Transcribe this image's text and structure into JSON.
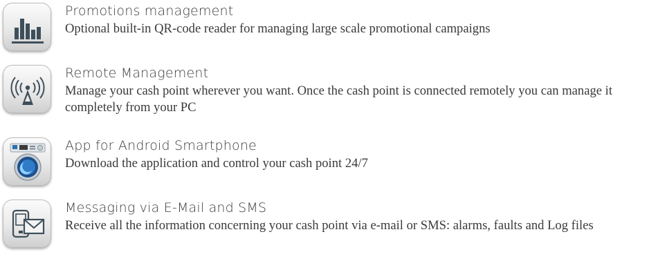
{
  "features": [
    {
      "icon": "bar-chart-icon",
      "title": "Promotions management",
      "description": "Optional built-in QR-code reader for managing large scale promotional campaigns"
    },
    {
      "icon": "antenna-signal-icon",
      "title": "Remote Management",
      "description": "Manage your cash point wherever you want. Once the cash point is connected remotely you can manage it completely from your PC"
    },
    {
      "icon": "washing-machine-icon",
      "title": "App for Android Smartphone",
      "description": "Download the application and control your cash point 24/7"
    },
    {
      "icon": "phone-envelope-icon",
      "title": "Messaging via E-Mail and SMS",
      "description": "Receive all the information concerning your cash point via e-mail or SMS: alarms, faults and Log files"
    }
  ]
}
